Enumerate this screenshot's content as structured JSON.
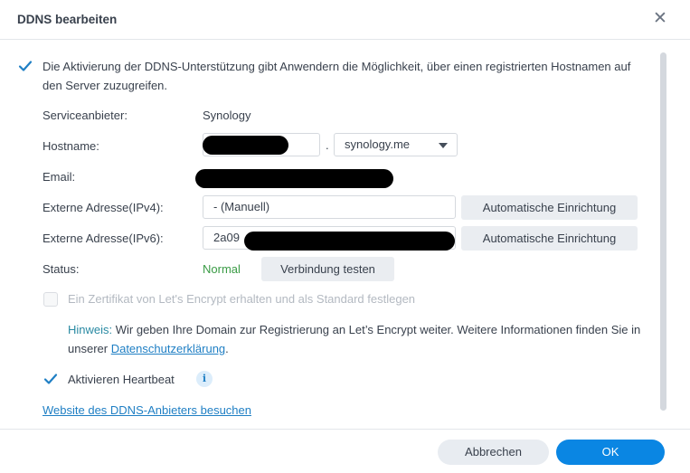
{
  "dialog": {
    "title": "DDNS bearbeiten",
    "close_icon": "close-icon"
  },
  "enable": {
    "checked": true,
    "text": "Die Aktivierung der DDNS-Unterstützung gibt Anwendern die Möglichkeit, über einen registrierten Hostnamen auf den Server zuzugreifen."
  },
  "fields": {
    "provider_label": "Serviceanbieter:",
    "provider_value": "Synology",
    "hostname_label": "Hostname:",
    "hostname_value": "",
    "hostname_dot": ".",
    "domain_value": "synology.me",
    "email_label": "Email:",
    "ipv4_label": "Externe Adresse(IPv4):",
    "ipv4_value": "- (Manuell)",
    "ipv4_button": "Automatische Einrichtung",
    "ipv6_label": "Externe Adresse(IPv6):",
    "ipv6_value": "2a09",
    "ipv6_button": "Automatische Einrichtung",
    "status_label": "Status:",
    "status_value": "Normal",
    "test_button": "Verbindung testen"
  },
  "certificate": {
    "checked": false,
    "disabled": true,
    "text": "Ein Zertifikat von Let's Encrypt erhalten und als Standard festlegen"
  },
  "hint": {
    "label": "Hinweis:",
    "text": " Wir geben Ihre Domain zur Registrierung an Let’s Encrypt weiter. Weitere Informationen finden Sie in unserer ",
    "link": "Datenschutzerklärung",
    "after": "."
  },
  "heartbeat": {
    "checked": true,
    "text": "Aktivieren Heartbeat",
    "info_icon": "i"
  },
  "provider_link": "Website des DDNS-Anbieters besuchen",
  "footer": {
    "cancel": "Abbrechen",
    "ok": "OK"
  },
  "colors": {
    "accent": "#0a86e3",
    "status_ok": "#3a9b45",
    "hint": "#2a8aa3",
    "link": "#1f7fc4"
  }
}
